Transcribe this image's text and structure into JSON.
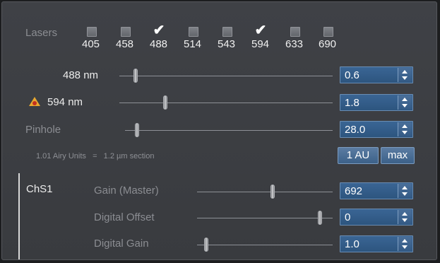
{
  "lasers": {
    "label": "Lasers",
    "items": [
      {
        "wavelength": "405",
        "checked": false
      },
      {
        "wavelength": "458",
        "checked": false
      },
      {
        "wavelength": "488",
        "checked": true
      },
      {
        "wavelength": "514",
        "checked": false
      },
      {
        "wavelength": "543",
        "checked": false
      },
      {
        "wavelength": "594",
        "checked": true
      },
      {
        "wavelength": "633",
        "checked": false
      },
      {
        "wavelength": "690",
        "checked": false
      }
    ]
  },
  "laser_rows": [
    {
      "label": "488 nm",
      "value": "0.6",
      "warning": false
    },
    {
      "label": "594 nm",
      "value": "1.8",
      "warning": true
    }
  ],
  "pinhole": {
    "label": "Pinhole",
    "value": "28.0",
    "info": "1.01 Airy Units   =   1.2 µm section",
    "btn_1au": "1 AU",
    "btn_max": "max"
  },
  "channel": {
    "name": "ChS1",
    "rows": [
      {
        "label": "Gain (Master)",
        "value": "692"
      },
      {
        "label": "Digital Offset",
        "value": "0"
      },
      {
        "label": "Digital Gain",
        "value": "1.0"
      }
    ]
  },
  "colors": {
    "field_bg": "#2d557f",
    "panel_bg": "#3c3e43",
    "warning": "#e8a830"
  }
}
